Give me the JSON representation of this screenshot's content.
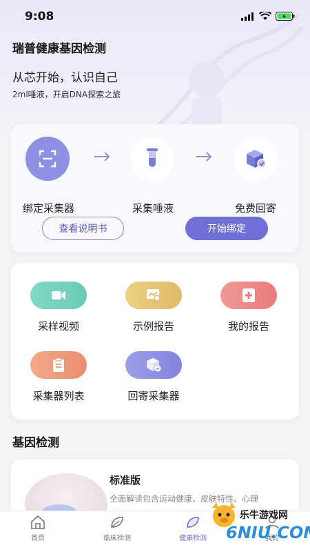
{
  "status_bar": {
    "time": "9:08"
  },
  "header": {
    "title": "瑞普健康基因检测"
  },
  "hero": {
    "headline": "从芯开始，认识自己",
    "subline": "2ml唾液，开启DNA探索之旅"
  },
  "steps": [
    {
      "label": "绑定采集器",
      "icon": "scan-icon"
    },
    {
      "label": "采集唾液",
      "icon": "test-tube-icon"
    },
    {
      "label": "免费回寄",
      "icon": "package-icon"
    }
  ],
  "step_buttons": {
    "manual": "查看说明书",
    "start": "开始绑定"
  },
  "menu": [
    {
      "label": "采样视频",
      "color": "#7fd8c3"
    },
    {
      "label": "示例报告",
      "color": "#e8c878"
    },
    {
      "label": "我的报告",
      "color": "#ef8a8a"
    },
    {
      "label": "采集器列表",
      "color": "#ef9c7a"
    },
    {
      "label": "回寄采集器",
      "color": "#8f90e3"
    }
  ],
  "section": {
    "title": "基因检测"
  },
  "product": {
    "title": "标准版",
    "desc": "全面解读包含运动健康、皮肤特性、心理"
  },
  "tabs": [
    {
      "label": "首页"
    },
    {
      "label": "临床检测"
    },
    {
      "label": "健康检测"
    },
    {
      "label": "我的"
    }
  ],
  "watermark": {
    "text": "乐牛游戏网",
    "brand": "6NIU.COM"
  },
  "colors": {
    "accent": "#6f6fd6",
    "step_active": "#8f90e3"
  }
}
